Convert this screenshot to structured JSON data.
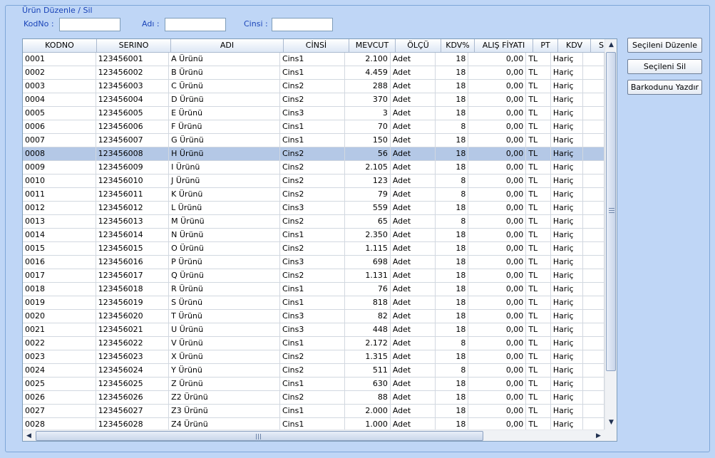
{
  "group_title": "Ürün Düzenle / Sil",
  "filters": {
    "kodno_label": "KodNo :",
    "kodno_value": "",
    "adi_label": "Adı :",
    "adi_value": "",
    "cinsi_label": "Cinsi :",
    "cinsi_value": ""
  },
  "grid": {
    "columns": [
      "KODNO",
      "SERINO",
      "ADI",
      "CİNSİ",
      "MEVCUT",
      "ÖLÇÜ",
      "KDV%",
      "ALIŞ FİYATI",
      "PT",
      "KDV",
      "S"
    ],
    "selected_row": 7,
    "rows": [
      [
        "0001",
        "123456001",
        "A Ürünü",
        "Cins1",
        "2.100",
        "Adet",
        "18",
        "0,00",
        "TL",
        "Hariç"
      ],
      [
        "0002",
        "123456002",
        "B Ürünü",
        "Cins1",
        "4.459",
        "Adet",
        "18",
        "0,00",
        "TL",
        "Hariç"
      ],
      [
        "0003",
        "123456003",
        "C Ürünü",
        "Cins2",
        "288",
        "Adet",
        "18",
        "0,00",
        "TL",
        "Hariç"
      ],
      [
        "0004",
        "123456004",
        "D Ürünü",
        "Cins2",
        "370",
        "Adet",
        "18",
        "0,00",
        "TL",
        "Hariç"
      ],
      [
        "0005",
        "123456005",
        "E Ürünü",
        "Cins3",
        "3",
        "Adet",
        "18",
        "0,00",
        "TL",
        "Hariç"
      ],
      [
        "0006",
        "123456006",
        "F Ürünü",
        "Cins1",
        "70",
        "Adet",
        "8",
        "0,00",
        "TL",
        "Hariç"
      ],
      [
        "0007",
        "123456007",
        "G Ürünü",
        "Cins1",
        "150",
        "Adet",
        "18",
        "0,00",
        "TL",
        "Hariç"
      ],
      [
        "0008",
        "123456008",
        "H Ürünü",
        "Cins2",
        "56",
        "Adet",
        "18",
        "0,00",
        "TL",
        "Hariç"
      ],
      [
        "0009",
        "123456009",
        "I Ürünü",
        "Cins2",
        "2.105",
        "Adet",
        "18",
        "0,00",
        "TL",
        "Hariç"
      ],
      [
        "0010",
        "123456010",
        "J Ürünü",
        "Cins2",
        "123",
        "Adet",
        "8",
        "0,00",
        "TL",
        "Hariç"
      ],
      [
        "0011",
        "123456011",
        "K Ürünü",
        "Cins2",
        "79",
        "Adet",
        "8",
        "0,00",
        "TL",
        "Hariç"
      ],
      [
        "0012",
        "123456012",
        "L Ürünü",
        "Cins3",
        "559",
        "Adet",
        "18",
        "0,00",
        "TL",
        "Hariç"
      ],
      [
        "0013",
        "123456013",
        "M Ürünü",
        "Cins2",
        "65",
        "Adet",
        "8",
        "0,00",
        "TL",
        "Hariç"
      ],
      [
        "0014",
        "123456014",
        "N Ürünü",
        "Cins1",
        "2.350",
        "Adet",
        "18",
        "0,00",
        "TL",
        "Hariç"
      ],
      [
        "0015",
        "123456015",
        "O Ürünü",
        "Cins2",
        "1.115",
        "Adet",
        "18",
        "0,00",
        "TL",
        "Hariç"
      ],
      [
        "0016",
        "123456016",
        "P Ürünü",
        "Cins3",
        "698",
        "Adet",
        "18",
        "0,00",
        "TL",
        "Hariç"
      ],
      [
        "0017",
        "123456017",
        "Q Ürünü",
        "Cins2",
        "1.131",
        "Adet",
        "18",
        "0,00",
        "TL",
        "Hariç"
      ],
      [
        "0018",
        "123456018",
        "R Ürünü",
        "Cins1",
        "76",
        "Adet",
        "18",
        "0,00",
        "TL",
        "Hariç"
      ],
      [
        "0019",
        "123456019",
        "S Ürünü",
        "Cins1",
        "818",
        "Adet",
        "18",
        "0,00",
        "TL",
        "Hariç"
      ],
      [
        "0020",
        "123456020",
        "T Ürünü",
        "Cins3",
        "82",
        "Adet",
        "18",
        "0,00",
        "TL",
        "Hariç"
      ],
      [
        "0021",
        "123456021",
        "U Ürünü",
        "Cins3",
        "448",
        "Adet",
        "18",
        "0,00",
        "TL",
        "Hariç"
      ],
      [
        "0022",
        "123456022",
        "V Ürünü",
        "Cins1",
        "2.172",
        "Adet",
        "8",
        "0,00",
        "TL",
        "Hariç"
      ],
      [
        "0023",
        "123456023",
        "X Ürünü",
        "Cins2",
        "1.315",
        "Adet",
        "18",
        "0,00",
        "TL",
        "Hariç"
      ],
      [
        "0024",
        "123456024",
        "Y Ürünü",
        "Cins2",
        "511",
        "Adet",
        "8",
        "0,00",
        "TL",
        "Hariç"
      ],
      [
        "0025",
        "123456025",
        "Z Ürünü",
        "Cins1",
        "630",
        "Adet",
        "18",
        "0,00",
        "TL",
        "Hariç"
      ],
      [
        "0026",
        "123456026",
        "Z2 Ürünü",
        "Cins2",
        "88",
        "Adet",
        "18",
        "0,00",
        "TL",
        "Hariç"
      ],
      [
        "0027",
        "123456027",
        "Z3 Ürünü",
        "Cins1",
        "2.000",
        "Adet",
        "18",
        "0,00",
        "TL",
        "Hariç"
      ],
      [
        "0028",
        "123456028",
        "Z4 Ürünü",
        "Cins1",
        "1.000",
        "Adet",
        "18",
        "0,00",
        "TL",
        "Hariç"
      ]
    ]
  },
  "buttons": {
    "edit_label": "Seçileni Düzenle",
    "delete_label": "Seçileni Sil",
    "barcode_label": "Barkodunu Yazdır"
  },
  "colors": {
    "background": "#bfd6f6",
    "label_blue": "#1a44b8",
    "selection": "#b4c8e6"
  }
}
